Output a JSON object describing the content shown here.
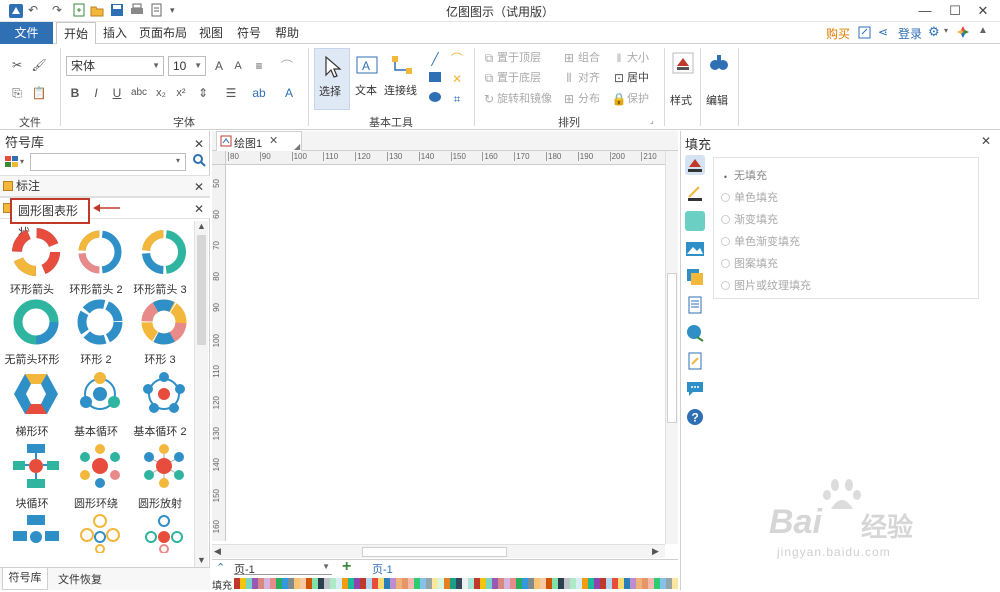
{
  "window": {
    "title": "亿图图示（试用版）"
  },
  "qat": {
    "undo": "↶",
    "redo": "↷",
    "save": "💾",
    "print": "⎙"
  },
  "tabs": [
    {
      "label": "文件"
    },
    {
      "label": "开始"
    },
    {
      "label": "插入"
    },
    {
      "label": "页面布局"
    },
    {
      "label": "视图"
    },
    {
      "label": "符号"
    },
    {
      "label": "帮助"
    }
  ],
  "account": {
    "buy": "购买",
    "login": "登录"
  },
  "ribbon": {
    "groups": {
      "file": "文件",
      "font": "字体",
      "basic_tools": "基本工具",
      "arrange": "排列"
    },
    "font_name": "宋体",
    "font_size": "10",
    "tools": {
      "select": "选择",
      "text": "文本",
      "connector": "连接线"
    },
    "arrange": {
      "bring_front": "置于顶层",
      "send_back": "置于底层",
      "rotate_mirror": "旋转和镜像",
      "group": "组合",
      "align": "对齐",
      "distribute": "分布",
      "size": "大小",
      "center": "居中",
      "protect": "保护"
    },
    "style": "样式",
    "edit": "编辑"
  },
  "symbol_panel": {
    "title": "符号库",
    "search_placeholder": "",
    "categories": [
      {
        "label": "标注"
      },
      {
        "label": "圆形图表形状"
      }
    ],
    "shapes": [
      {
        "label": "环形箭头"
      },
      {
        "label": "环形箭头 2"
      },
      {
        "label": "环形箭头 3"
      },
      {
        "label": "无箭头环形"
      },
      {
        "label": "环形 2"
      },
      {
        "label": "环形 3"
      },
      {
        "label": "梯形环"
      },
      {
        "label": "基本循环"
      },
      {
        "label": "基本循环 2"
      },
      {
        "label": "块循环"
      },
      {
        "label": "圆形环绕"
      },
      {
        "label": "圆形放射"
      }
    ],
    "bottom_tabs": [
      {
        "label": "符号库"
      },
      {
        "label": "文件恢复"
      }
    ]
  },
  "document": {
    "tab_label": "绘图1",
    "ruler_h": [
      "80",
      "90",
      "100",
      "110",
      "120",
      "130",
      "140",
      "150",
      "160",
      "170",
      "180",
      "190",
      "200",
      "210"
    ],
    "ruler_v": [
      "50",
      "60",
      "70",
      "80",
      "90",
      "100",
      "110",
      "120",
      "130",
      "140",
      "150",
      "160"
    ],
    "page_selector": "页-1",
    "page_tab": "页-1",
    "fill_label": "填充"
  },
  "fill_panel": {
    "title": "填充",
    "options": [
      {
        "label": "无填充"
      },
      {
        "label": "单色填充"
      },
      {
        "label": "渐变填充"
      },
      {
        "label": "单色渐变填充"
      },
      {
        "label": "图案填充"
      },
      {
        "label": "图片或纹理填充"
      }
    ]
  },
  "watermark": {
    "brand": "Bai",
    "brand_cn": "经验",
    "url": "jingyan.baidu.com"
  },
  "colors": {
    "accent": "#2f6fb4",
    "callout": "#c0392b",
    "buy": "#e07a00"
  }
}
